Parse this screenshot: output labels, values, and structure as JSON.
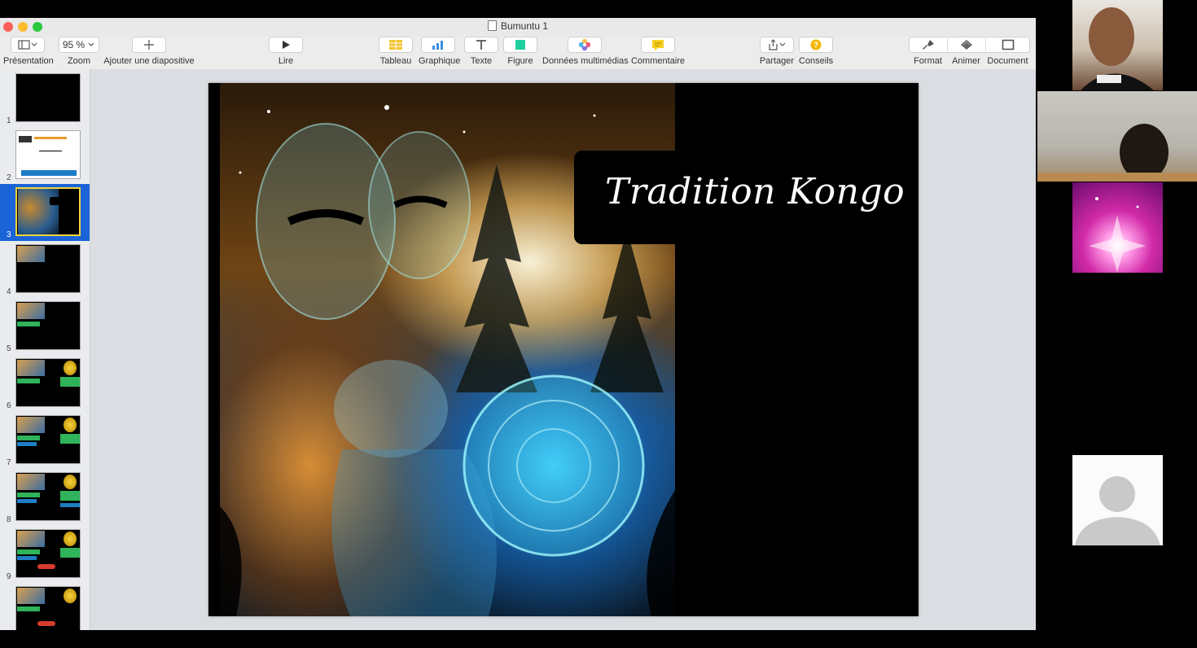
{
  "window": {
    "title": "Bumuntu 1"
  },
  "toolbar": {
    "view": {
      "label": "Présentation"
    },
    "zoom": {
      "value": "95 %",
      "label": "Zoom"
    },
    "add_slide": {
      "label": "Ajouter une diapositive"
    },
    "play": {
      "label": "Lire"
    },
    "table": {
      "label": "Tableau"
    },
    "chart": {
      "label": "Graphique"
    },
    "text": {
      "label": "Texte"
    },
    "shape": {
      "label": "Figure"
    },
    "media": {
      "label": "Données multimédias"
    },
    "comment": {
      "label": "Commentaire"
    },
    "share": {
      "label": "Partager"
    },
    "tips": {
      "label": "Conseils"
    },
    "format": {
      "label": "Format"
    },
    "animate": {
      "label": "Animer"
    },
    "document": {
      "label": "Document"
    }
  },
  "sidebar": {
    "slides": [
      {
        "num": "1"
      },
      {
        "num": "2"
      },
      {
        "num": "3"
      },
      {
        "num": "4"
      },
      {
        "num": "5"
      },
      {
        "num": "6"
      },
      {
        "num": "7"
      },
      {
        "num": "8"
      },
      {
        "num": "9"
      }
    ],
    "selected": "3"
  },
  "slide": {
    "title": "Tradition Kongo"
  },
  "colors": {
    "accent": "#1a64d8",
    "selection_border": "#f2d33b",
    "slide_bg": "#000000"
  },
  "icons": {
    "view": "sidebar-view-icon",
    "add": "plus-icon",
    "play": "play-icon",
    "table": "table-icon",
    "chart": "bar-chart-icon",
    "text": "text-icon",
    "shape": "shape-icon",
    "media": "media-icon",
    "comment": "comment-icon",
    "share": "share-icon",
    "tips": "question-icon",
    "format": "brush-icon",
    "animate": "diamond-icon",
    "document": "document-icon"
  }
}
